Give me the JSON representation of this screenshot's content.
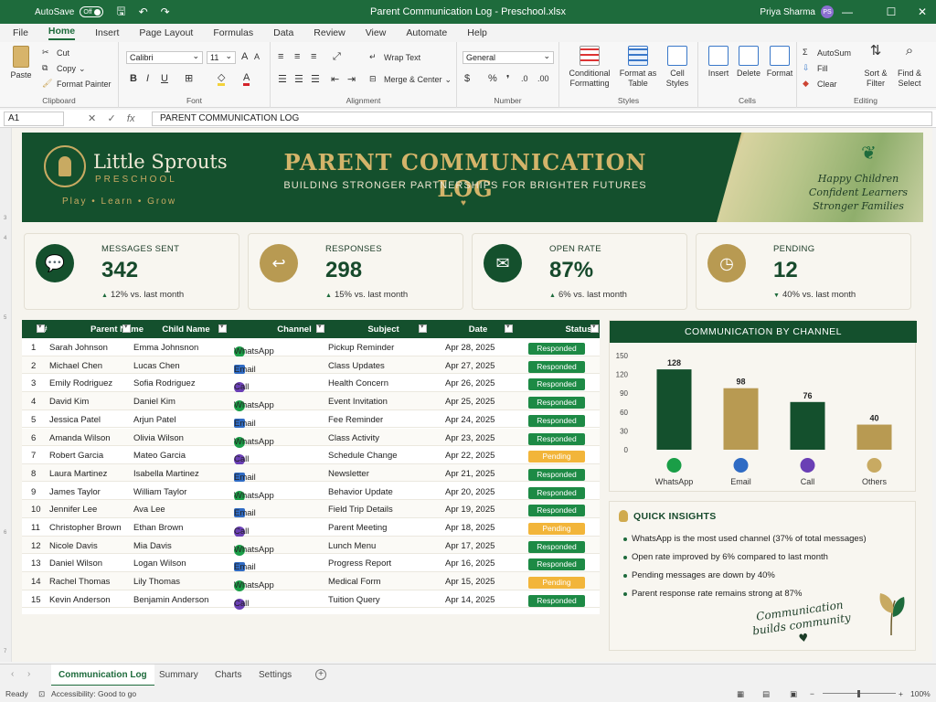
{
  "window": {
    "autosave_label": "AutoSave",
    "autosave_state": "Off",
    "title": "Parent Communication Log - Preschool.xlsx",
    "user_name": "Priya Sharma",
    "user_initials": "PS"
  },
  "ribbon_tabs": [
    "File",
    "Home",
    "Insert",
    "Page Layout",
    "Formulas",
    "Data",
    "Review",
    "View",
    "Automate",
    "Help"
  ],
  "ribbon": {
    "clipboard": {
      "paste": "Paste",
      "cut": "Cut",
      "copy": "Copy",
      "format_painter": "Format Painter",
      "label": "Clipboard"
    },
    "font": {
      "name": "Calibri",
      "size": "11",
      "label": "Font"
    },
    "alignment": {
      "wrap_text": "Wrap Text",
      "merge_center": "Merge & Center",
      "label": "Alignment"
    },
    "number": {
      "format": "General",
      "label": "Number"
    },
    "styles": {
      "conditional": "Conditional",
      "formatting": "Formatting",
      "format_as": "Format as",
      "table": "Table",
      "cell": "Cell",
      "styles_btn": "Styles",
      "label": "Styles"
    },
    "cells": {
      "insert": "Insert",
      "delete": "Delete",
      "format": "Format",
      "label": "Cells"
    },
    "editing": {
      "autosum": "AutoSum",
      "fill": "Fill",
      "clear": "Clear",
      "sort_1": "Sort &",
      "sort_2": "Filter",
      "find_1": "Find &",
      "find_2": "Select",
      "label": "Editing"
    }
  },
  "formula_bar": {
    "cell_ref": "A1",
    "content": "PARENT COMMUNICATION LOG"
  },
  "banner": {
    "brand_name": "Little Sprouts",
    "brand_sub": "PRESCHOOL",
    "brand_tag": "Play  •  Learn  •  Grow",
    "title": "PARENT COMMUNICATION LOG",
    "subtitle": "BUILDING STRONGER PARTNERSHIPS FOR BRIGHTER FUTURES",
    "quote_1": "Happy Children",
    "quote_2": "Confident Learners",
    "quote_3": "Stronger Families"
  },
  "kpis": [
    {
      "label": "MESSAGES SENT",
      "value": "342",
      "delta": "12% vs. last month",
      "direction": "up",
      "color": "#14502d",
      "icon": "chat-icon"
    },
    {
      "label": "RESPONSES",
      "value": "298",
      "delta": "15% vs. last month",
      "direction": "up",
      "color": "#b89a52",
      "icon": "reply-icon"
    },
    {
      "label": "OPEN RATE",
      "value": "87%",
      "delta": "6% vs. last month",
      "direction": "up",
      "color": "#14502d",
      "icon": "envelope-icon"
    },
    {
      "label": "PENDING",
      "value": "12",
      "delta": "40% vs. last month",
      "direction": "down",
      "color": "#b89a52",
      "icon": "clock-icon"
    }
  ],
  "table": {
    "headers": [
      "#",
      "Parent Name",
      "Child Name",
      "Channel",
      "Subject",
      "Date",
      "Status"
    ],
    "rows": [
      {
        "n": "1",
        "parent": "Sarah Johnson",
        "child": "Emma Johnsnon",
        "channel": "WhatsApp",
        "subject": "Pickup Reminder",
        "date": "Apr 28, 2025",
        "status": "Responded"
      },
      {
        "n": "2",
        "parent": "Michael Chen",
        "child": "Lucas Chen",
        "channel": "Email",
        "subject": "Class Updates",
        "date": "Apr 27, 2025",
        "status": "Responded"
      },
      {
        "n": "3",
        "parent": "Emily Rodriguez",
        "child": "Sofia Rodriguez",
        "channel": "Call",
        "subject": "Health Concern",
        "date": "Apr 26, 2025",
        "status": "Responded"
      },
      {
        "n": "4",
        "parent": "David Kim",
        "child": "Daniel Kim",
        "channel": "WhatsApp",
        "subject": "Event Invitation",
        "date": "Apr 25, 2025",
        "status": "Responded"
      },
      {
        "n": "5",
        "parent": "Jessica Patel",
        "child": "Arjun Patel",
        "channel": "Email",
        "subject": "Fee Reminder",
        "date": "Apr 24, 2025",
        "status": "Responded"
      },
      {
        "n": "6",
        "parent": "Amanda Wilson",
        "child": "Olivia Wilson",
        "channel": "WhatsApp",
        "subject": "Class Activity",
        "date": "Apr 23, 2025",
        "status": "Responded"
      },
      {
        "n": "7",
        "parent": "Robert Garcia",
        "child": "Mateo Garcia",
        "channel": "Call",
        "subject": "Schedule Change",
        "date": "Apr 22, 2025",
        "status": "Pending"
      },
      {
        "n": "8",
        "parent": "Laura Martinez",
        "child": "Isabella Martinez",
        "channel": "Email",
        "subject": "Newsletter",
        "date": "Apr 21, 2025",
        "status": "Responded"
      },
      {
        "n": "9",
        "parent": "James Taylor",
        "child": "William Taylor",
        "channel": "WhatsApp",
        "subject": "Behavior Update",
        "date": "Apr 20, 2025",
        "status": "Responded"
      },
      {
        "n": "10",
        "parent": "Jennifer Lee",
        "child": "Ava Lee",
        "channel": "Email",
        "subject": "Field Trip Details",
        "date": "Apr 19, 2025",
        "status": "Responded"
      },
      {
        "n": "11",
        "parent": "Christopher Brown",
        "child": "Ethan Brown",
        "channel": "Call",
        "subject": "Parent Meeting",
        "date": "Apr 18, 2025",
        "status": "Pending"
      },
      {
        "n": "12",
        "parent": "Nicole Davis",
        "child": "Mia Davis",
        "channel": "WhatsApp",
        "subject": "Lunch Menu",
        "date": "Apr 17, 2025",
        "status": "Responded"
      },
      {
        "n": "13",
        "parent": "Daniel Wilson",
        "child": "Logan Wilson",
        "channel": "Email",
        "subject": "Progress Report",
        "date": "Apr 16, 2025",
        "status": "Responded"
      },
      {
        "n": "14",
        "parent": "Rachel Thomas",
        "child": "Lily Thomas",
        "channel": "WhatsApp",
        "subject": "Medical Form",
        "date": "Apr 15, 2025",
        "status": "Pending"
      },
      {
        "n": "15",
        "parent": "Kevin Anderson",
        "child": "Benjamin Anderson",
        "channel": "Call",
        "subject": "Tuition Query",
        "date": "Apr 14, 2025",
        "status": "Responded"
      }
    ]
  },
  "chart_data": {
    "type": "bar",
    "title": "COMMUNICATION BY CHANNEL",
    "categories": [
      "WhatsApp",
      "Email",
      "Call",
      "Others"
    ],
    "values": [
      128,
      98,
      76,
      40
    ],
    "bar_colors": [
      "#14502d",
      "#b89a52",
      "#14502d",
      "#b89a52"
    ],
    "icon_colors": [
      "#1a9e47",
      "#2f6bc4",
      "#6a3fb5",
      "#c8aa62"
    ],
    "yticks": [
      0,
      30,
      60,
      90,
      120,
      150
    ],
    "ylim": [
      0,
      150
    ],
    "grid": false,
    "legend": "none"
  },
  "insights": {
    "title": "QUICK INSIGHTS",
    "items": [
      "WhatsApp is the most used channel (37% of total messages)",
      "Open rate improved by 6% compared to last month",
      "Pending messages are down by 40%",
      "Parent response rate remains strong at 87%"
    ],
    "quote_1": "Communication",
    "quote_2": "builds community"
  },
  "sheet_tabs": [
    "Communication Log",
    "Summary",
    "Charts",
    "Settings"
  ],
  "statusbar": {
    "ready": "Ready",
    "accessibility": "Accessibility: Good to go",
    "zoom": "100%"
  },
  "colors": {
    "accent": "#1e6b3c",
    "dark_green": "#14502d",
    "gold": "#b89a52"
  }
}
